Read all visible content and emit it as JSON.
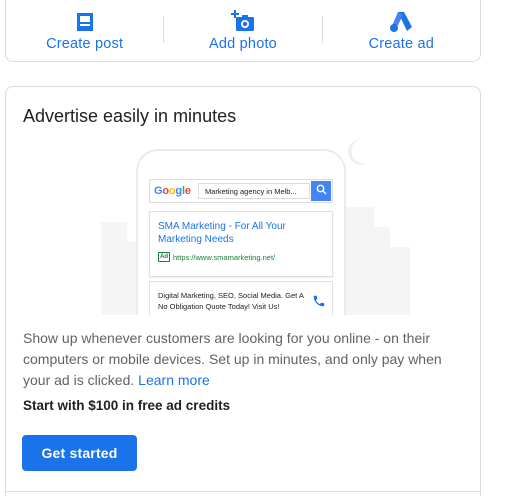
{
  "actions": [
    {
      "label": "Create post",
      "icon": "create-post-icon"
    },
    {
      "label": "Add photo",
      "icon": "add-photo-icon"
    },
    {
      "label": "Create ad",
      "icon": "google-ads-logo-icon"
    }
  ],
  "ad_card": {
    "title": "Advertise easily in minutes",
    "illustration": {
      "logo_text": "Google",
      "search_query": "Marketing agency in Melb...",
      "result_title": "SMA Marketing - For All Your Marketing Needs",
      "ad_badge": "Ad",
      "result_url": "https://www.smamarketing.net/",
      "result_description": "Digital Marketing, SEO, Social Media. Get A No Obligation Quote Today! Visit Us!"
    },
    "body_text": "Show up whenever customers are looking for you online - on their computers or mobile devices. Set up in minutes, and only pay when your ad is clicked.",
    "learn_more": "Learn more",
    "credits_text": "Start with $100 in free ad credits",
    "cta_label": "Get started"
  },
  "colors": {
    "accent": "#1a73e8",
    "url_green": "#188038",
    "text_primary": "#202124",
    "text_secondary": "#5f6368",
    "border": "#dadce0"
  }
}
